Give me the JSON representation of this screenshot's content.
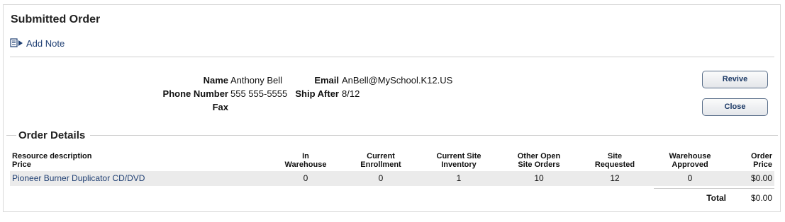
{
  "header": {
    "title": "Submitted Order",
    "add_note_label": "Add Note"
  },
  "contact": {
    "name_label": "Name",
    "name_value": "Anthony Bell",
    "phone_label": "Phone Number",
    "phone_value": "555 555-5555",
    "fax_label": "Fax",
    "fax_value": "",
    "email_label": "Email",
    "email_value": "AnBell@MySchool.K12.US",
    "ship_after_label": "Ship After",
    "ship_after_value": "8/12"
  },
  "actions": {
    "revive_label": "Revive",
    "close_label": "Close"
  },
  "details": {
    "legend": "Order Details",
    "headers": {
      "resource_line1": "Resource description",
      "resource_line2": "Price",
      "in_warehouse_1": "In",
      "in_warehouse_2": "Warehouse",
      "current_enrollment_1": "Current",
      "current_enrollment_2": "Enrollment",
      "site_inventory_1": "Current Site",
      "site_inventory_2": "Inventory",
      "other_open_1": "Other Open",
      "other_open_2": "Site Orders",
      "site_requested_1": "Site",
      "site_requested_2": "Requested",
      "warehouse_approved_1": "Warehouse",
      "warehouse_approved_2": "Approved",
      "order_price_1": "Order",
      "order_price_2": "Price"
    },
    "rows": [
      {
        "resource": "Pioneer Burner Duplicator CD/DVD",
        "in_warehouse": "0",
        "current_enrollment": "0",
        "site_inventory": "1",
        "other_open": "10",
        "site_requested": "12",
        "warehouse_approved": "0",
        "order_price": "$0.00"
      }
    ],
    "total_label": "Total",
    "total_value": "$0.00"
  },
  "colors": {
    "link": "#1f3f73",
    "row_bg": "#ebebeb",
    "button_border": "#5a6f8a"
  },
  "icons": {
    "add_note": "note-arrow-icon"
  }
}
